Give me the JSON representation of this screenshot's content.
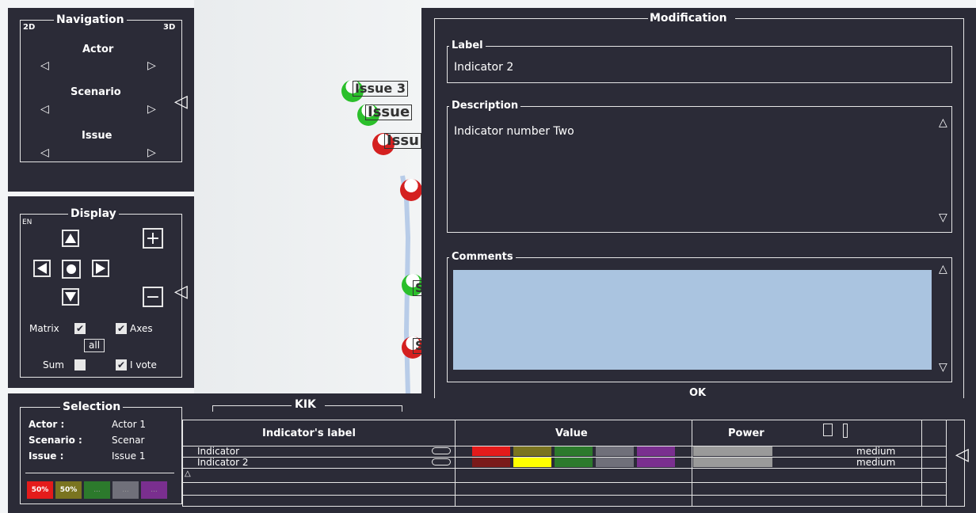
{
  "navigation": {
    "title": "Navigation",
    "left_badge": "2D",
    "right_badge": "3D",
    "actor_label": "Actor",
    "scenario_label": "Scenario",
    "issue_label": "Issue",
    "arrow_left": "◁",
    "arrow_right": "▷"
  },
  "display": {
    "title": "Display",
    "lang_badge": "EN",
    "matrix_label": "Matrix",
    "axes_label": "Axes",
    "all_label": "all",
    "sum_label": "Sum",
    "ivote_label": "I vote",
    "check_mark": "✔",
    "zoom_in": "+",
    "zoom_out": "−"
  },
  "graph": {
    "issue3": "Issue 3",
    "issue2": "Issue",
    "issue1": "Issu",
    "s1": "S",
    "s2": "S"
  },
  "selection": {
    "title": "Selection",
    "actor_key": "Actor :",
    "actor_val": "Actor 1",
    "scenario_key": "Scenario :",
    "scenario_val": "Scenar",
    "issue_key": "Issue :",
    "issue_val": "Issue 1",
    "swatches": [
      {
        "label": "50%",
        "color": "#e41b1b"
      },
      {
        "label": "50%",
        "color": "#7a7420"
      },
      {
        "label": "...",
        "color": "#2c7a2c"
      },
      {
        "label": "...",
        "color": "#70707a"
      },
      {
        "label": "...",
        "color": "#7a2f8f"
      }
    ]
  },
  "kik": {
    "title": "KIK",
    "col_label": "Indicator's label",
    "col_value": "Value",
    "col_power": "Power",
    "rows": [
      {
        "label": "Indicator",
        "power": "medium"
      },
      {
        "label": "Indicator 2",
        "power": "medium"
      }
    ]
  },
  "modification": {
    "title": "Modification",
    "label_title": "Label",
    "label_value": "Indicator 2",
    "description_title": "Description",
    "description_value": "Indicator number Two",
    "comments_title": "Comments",
    "ok_label": "OK",
    "up": "△",
    "down": "▽"
  },
  "colors": {
    "panel": "#2b2b37",
    "comment_box": "#aac4e0",
    "red": "#e41b1b",
    "olive": "#7a7420",
    "green": "#2c7a2c",
    "gray": "#70707a",
    "purple": "#7a2f8f",
    "yellow": "#ffff00"
  }
}
